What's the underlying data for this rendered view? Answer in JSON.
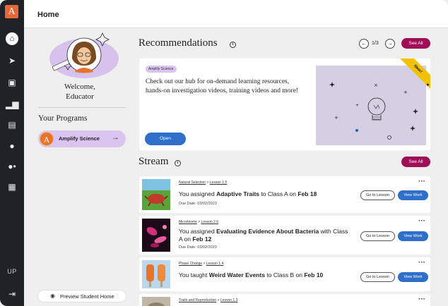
{
  "rail": {
    "logo": "A",
    "icons": [
      "home-icon",
      "rocket-icon",
      "bookmark-icon",
      "bar-chart-icon",
      "document-icon",
      "person-icon",
      "group-icon",
      "grid-icon",
      "exit-icon"
    ],
    "user_initials": "UP"
  },
  "header": {
    "title": "Home"
  },
  "welcome": {
    "line1": "Welcome,",
    "line2": "Educator"
  },
  "programs": {
    "title": "Your Programs",
    "items": [
      {
        "label": "Amplify Science",
        "initial": "A"
      }
    ]
  },
  "preview_label": "Preview Student Home",
  "recommendations": {
    "title": "Recommendations",
    "pager": "1/3",
    "see_all": "See All",
    "card": {
      "tag": "Amplify Science",
      "text": "Check out our hub for on-demand learning resources, hands-on investigation videos, training videos and more!",
      "open_label": "Open",
      "ribbon": "New!"
    }
  },
  "stream": {
    "title": "Stream",
    "see_all": "See All",
    "go_label": "Go to Lesson",
    "view_label": "View Work",
    "items": [
      {
        "crumb_unit": "Natural Selection",
        "crumb_lesson": "Lesson 1.5",
        "pre": "You assigned ",
        "bold": "Adaptive Traits",
        "mid": " to Class A on ",
        "date": "Feb 18",
        "due": "Due Date: 03/02/2023"
      },
      {
        "crumb_unit": "Microbiome",
        "crumb_lesson": "Lesson 2.6",
        "pre": "You assigned ",
        "bold": "Evaluating Evidence About Bacteria",
        "mid": " with Class A on ",
        "date": "Feb 12",
        "due": "Due Date: 03/02/2023"
      },
      {
        "crumb_unit": "Phase Change",
        "crumb_lesson": "Lesson 1.4",
        "pre": "You taught ",
        "bold": "Weird Water Events",
        "mid": " to Class B on ",
        "date": "Feb 10",
        "due": ""
      },
      {
        "crumb_unit": "Traits and Reproduction",
        "crumb_lesson": "Lesson 1.3",
        "pre": "",
        "bold": "",
        "mid": "",
        "date": "",
        "due": ""
      }
    ]
  },
  "colors": {
    "accent": "#9e0e57",
    "primary_blue": "#2f6fca",
    "lavender": "#d9c5ef",
    "rail": "#1f2327",
    "logo_orange": "#e5673a"
  }
}
